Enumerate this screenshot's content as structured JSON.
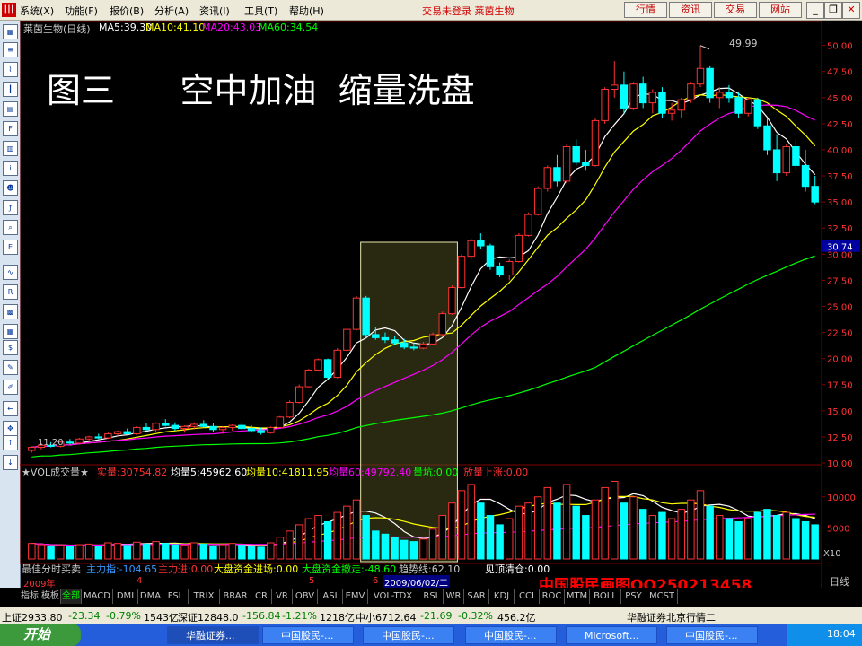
{
  "menu": {
    "items": [
      "系统(X)",
      "功能(F)",
      "报价(B)",
      "分析(A)",
      "资讯(I)",
      "工具(T)",
      "帮助(H)"
    ],
    "title": "交易未登录  莱茵生物",
    "buttons": [
      "行情",
      "资讯",
      "交易",
      "网站"
    ]
  },
  "chart": {
    "header": {
      "name": "莱茵生物(日线)",
      "ma5": "MA5:39.30",
      "ma10": "MA10:41.10",
      "ma20": "MA20:43.03",
      "ma60": "MA60:34.54"
    },
    "big_title": "图三      空中加油  缩量洗盘",
    "high_label": "49.99",
    "low_label": "11.20",
    "price_ticks": [
      "50.00",
      "47.50",
      "45.00",
      "42.50",
      "40.00",
      "37.50",
      "35.00",
      "32.50",
      "30.74",
      "30.00",
      "27.50",
      "25.00",
      "22.50",
      "20.00",
      "17.50",
      "15.00",
      "12.50",
      "10.00"
    ],
    "current_price": "30.74",
    "colors": {
      "up": "#ff3232",
      "down": "#00ffff",
      "ma5": "#ffffff",
      "ma10": "#ffff00",
      "ma20": "#ff00ff",
      "ma60": "#00ff00",
      "grid": "#800000"
    }
  },
  "volume": {
    "header": {
      "title": "★VOL成交量★",
      "actual": "实量:30754.82",
      "avg5": "均量5:45962.60",
      "avg10": "均量10:41811.95",
      "avg60": "均量60:49792.40",
      "trend": "量坑:0.00",
      "warning": "放量上涨:0.00"
    },
    "ticks": [
      "10000",
      "5000"
    ],
    "unit": "X10"
  },
  "info_row": {
    "label": "最佳分时买卖",
    "main_index": "主力指:-104.65",
    "main_in": "主力进:0.00",
    "big_in": "大盘资金进场:0.00",
    "big_out": "大盘资金撤走:-48.60",
    "trend_line": "趋势线:62.10",
    "top_warn": "见顶清仓:0.00"
  },
  "timeline": {
    "y2009": "2009年",
    "m4": "4",
    "m5": "5",
    "m6": "6",
    "cursor_date": "2009/06/02/二",
    "period": "日线"
  },
  "watermark": "中国股民画图QQ250213458",
  "indicator_tabs": [
    "指标",
    "模板",
    "全部",
    "MACD",
    "DMI",
    "DMA",
    "FSL",
    "TRIX",
    "BRAR",
    "CR",
    "VR",
    "OBV",
    "ASI",
    "EMV",
    "VOL-TDX",
    "RSI",
    "WR",
    "SAR",
    "KDJ",
    "CCI",
    "ROC",
    "MTM",
    "BOLL",
    "PSY",
    "MCST"
  ],
  "status": {
    "sh": "上证2933.80",
    "sh_chg": "-23.34",
    "sh_pct": "-0.79%",
    "sh_amt": "1543亿",
    "sz": "深证12848.0",
    "sz_chg": "-156.84",
    "sz_pct": "-1.21%",
    "sz_amt": "1218亿",
    "zx": "中小6712.64",
    "zx_chg": "-21.69",
    "zx_pct": "-0.32%",
    "zx_amt": "456.2亿",
    "server": "华融证券北京行情二"
  },
  "taskbar": {
    "start": "开始",
    "tasks": [
      "华融证券...",
      "中国股民-...",
      "中国股民-...",
      "中国股民-...",
      "Microsoft...",
      "中国股民-..."
    ],
    "clock": "18:04"
  },
  "chart_data": {
    "type": "candlestick",
    "y_range": [
      10,
      51
    ],
    "volume_range": [
      0,
      13000
    ],
    "candles": [
      [
        11.2,
        11.6,
        11.0,
        11.5
      ],
      [
        11.5,
        11.9,
        11.3,
        11.7
      ],
      [
        11.7,
        12.0,
        11.5,
        11.6
      ],
      [
        11.6,
        12.1,
        11.5,
        12.0
      ],
      [
        12.0,
        12.3,
        11.8,
        11.9
      ],
      [
        11.9,
        12.4,
        11.8,
        12.3
      ],
      [
        12.3,
        12.6,
        12.1,
        12.5
      ],
      [
        12.5,
        12.8,
        12.3,
        12.4
      ],
      [
        12.4,
        12.9,
        12.3,
        12.8
      ],
      [
        12.8,
        13.1,
        12.6,
        13.0
      ],
      [
        13.0,
        13.3,
        12.7,
        12.8
      ],
      [
        12.8,
        13.5,
        12.7,
        13.4
      ],
      [
        13.4,
        13.8,
        13.1,
        13.2
      ],
      [
        13.2,
        13.9,
        13.0,
        13.8
      ],
      [
        13.8,
        14.2,
        13.5,
        13.6
      ],
      [
        13.6,
        13.9,
        13.1,
        13.3
      ],
      [
        13.3,
        13.6,
        12.9,
        13.5
      ],
      [
        13.5,
        13.9,
        13.2,
        13.7
      ],
      [
        13.7,
        14.1,
        13.4,
        13.5
      ],
      [
        13.5,
        13.8,
        13.0,
        13.2
      ],
      [
        13.2,
        13.5,
        12.8,
        13.4
      ],
      [
        13.4,
        13.7,
        13.1,
        13.6
      ],
      [
        13.6,
        13.9,
        13.2,
        13.3
      ],
      [
        13.3,
        13.6,
        12.9,
        13.1
      ],
      [
        13.1,
        13.4,
        12.7,
        12.9
      ],
      [
        12.9,
        13.5,
        12.8,
        13.4
      ],
      [
        13.4,
        14.5,
        13.3,
        14.4
      ],
      [
        14.4,
        16.0,
        14.3,
        15.8
      ],
      [
        15.8,
        17.5,
        15.7,
        17.3
      ],
      [
        17.3,
        19.0,
        17.2,
        18.9
      ],
      [
        18.9,
        20.0,
        18.8,
        19.9
      ],
      [
        19.9,
        20.0,
        18.0,
        18.2
      ],
      [
        18.2,
        21.0,
        18.1,
        20.8
      ],
      [
        20.8,
        23.0,
        20.7,
        22.8
      ],
      [
        22.8,
        26.0,
        22.7,
        25.8
      ],
      [
        25.8,
        26.0,
        22.0,
        22.3
      ],
      [
        22.3,
        23.0,
        21.8,
        22.0
      ],
      [
        22.0,
        22.5,
        21.5,
        21.8
      ],
      [
        21.8,
        22.2,
        21.3,
        21.5
      ],
      [
        21.5,
        21.9,
        20.9,
        21.1
      ],
      [
        21.1,
        21.5,
        20.8,
        21.0
      ],
      [
        21.0,
        21.6,
        20.9,
        21.4
      ],
      [
        21.4,
        22.5,
        21.3,
        22.3
      ],
      [
        22.3,
        24.5,
        22.2,
        24.3
      ],
      [
        24.3,
        27.0,
        24.2,
        26.8
      ],
      [
        26.8,
        30.0,
        26.7,
        29.8
      ],
      [
        29.8,
        31.5,
        29.5,
        31.3
      ],
      [
        31.3,
        32.0,
        30.5,
        30.8
      ],
      [
        30.8,
        31.0,
        28.5,
        28.8
      ],
      [
        28.8,
        29.2,
        27.8,
        28.0
      ],
      [
        28.0,
        29.5,
        27.5,
        29.3
      ],
      [
        29.3,
        32.0,
        29.2,
        31.8
      ],
      [
        31.8,
        34.0,
        31.7,
        33.8
      ],
      [
        33.8,
        36.5,
        33.7,
        36.3
      ],
      [
        36.3,
        38.5,
        36.0,
        38.3
      ],
      [
        38.3,
        39.5,
        36.5,
        37.0
      ],
      [
        37.0,
        40.5,
        36.8,
        40.3
      ],
      [
        40.3,
        41.0,
        38.5,
        38.8
      ],
      [
        38.8,
        40.0,
        38.0,
        38.5
      ],
      [
        38.5,
        43.0,
        38.4,
        42.8
      ],
      [
        42.8,
        46.0,
        42.5,
        45.8
      ],
      [
        45.8,
        48.5,
        45.0,
        46.2
      ],
      [
        46.2,
        47.5,
        43.5,
        44.0
      ],
      [
        44.0,
        46.5,
        43.8,
        46.3
      ],
      [
        46.3,
        47.0,
        44.0,
        44.5
      ],
      [
        44.5,
        45.8,
        43.5,
        45.5
      ],
      [
        45.5,
        46.0,
        43.0,
        43.5
      ],
      [
        43.5,
        44.5,
        42.8,
        43.8
      ],
      [
        43.8,
        45.0,
        43.0,
        44.8
      ],
      [
        44.8,
        46.5,
        44.5,
        46.3
      ],
      [
        46.3,
        49.99,
        46.0,
        47.8
      ],
      [
        47.8,
        48.0,
        44.5,
        45.0
      ],
      [
        45.0,
        46.0,
        44.0,
        45.5
      ],
      [
        45.5,
        46.2,
        44.5,
        45.0
      ],
      [
        45.0,
        45.5,
        43.0,
        43.5
      ],
      [
        43.5,
        45.0,
        43.2,
        44.8
      ],
      [
        44.8,
        45.0,
        42.0,
        42.3
      ],
      [
        42.3,
        43.0,
        39.5,
        40.0
      ],
      [
        40.0,
        41.5,
        37.0,
        37.8
      ],
      [
        37.8,
        40.5,
        37.5,
        40.3
      ],
      [
        40.3,
        41.0,
        38.0,
        38.5
      ],
      [
        38.5,
        40.0,
        36.0,
        36.5
      ],
      [
        36.5,
        37.5,
        34.8,
        35.0
      ]
    ],
    "volumes": [
      2500,
      2300,
      2100,
      2200,
      2000,
      2300,
      2400,
      2100,
      2600,
      2500,
      2200,
      2700,
      2400,
      2800,
      2500,
      2300,
      2200,
      2600,
      2400,
      2100,
      2300,
      2500,
      2200,
      2000,
      1900,
      2600,
      3500,
      4500,
      5500,
      6500,
      7000,
      6000,
      7500,
      8500,
      9500,
      7000,
      4500,
      4000,
      3500,
      3000,
      2800,
      3200,
      4800,
      7000,
      9000,
      11000,
      12000,
      9000,
      7000,
      5500,
      6500,
      8500,
      9000,
      10000,
      11500,
      9000,
      12000,
      8500,
      7000,
      9500,
      11500,
      12500,
      9000,
      10000,
      8000,
      7000,
      7500,
      6500,
      8000,
      9500,
      11000,
      8500,
      7000,
      6500,
      6000,
      6500,
      7500,
      8000,
      7000,
      7500,
      6500,
      6000,
      5500
    ]
  }
}
